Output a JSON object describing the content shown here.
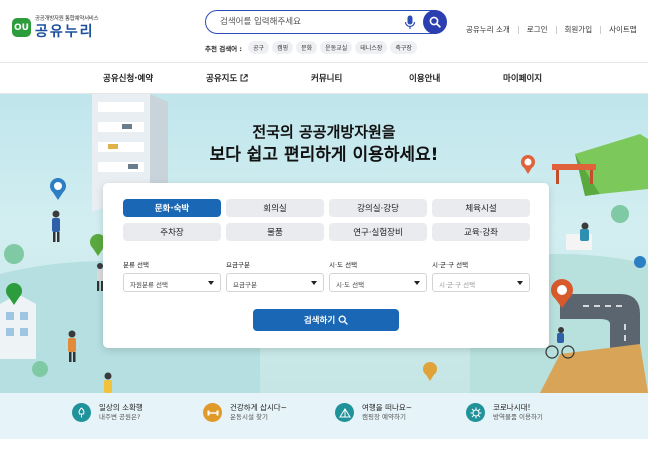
{
  "brand": {
    "mark": "OU",
    "subtitle": "공공개방자원 통합예약서비스",
    "name": "공유누리"
  },
  "search": {
    "placeholder": "검색어를 입력해주세요",
    "recommended_label": "추천 검색어 :",
    "recommended": [
      "공구",
      "캠핑",
      "문화",
      "운동교실",
      "테니스장",
      "축구장"
    ]
  },
  "utility_links": [
    "공유누리 소개",
    "로그인",
    "회원가입",
    "사이트맵"
  ],
  "nav": [
    "공유신청·예약",
    "공유지도",
    "커뮤니티",
    "이용안내",
    "마이페이지"
  ],
  "hero": {
    "title_line1": "전국의 공공개방자원을",
    "title_line2": "보다 쉽고 편리하게 이용하세요!"
  },
  "categories": [
    {
      "label": "문화·숙박",
      "active": true
    },
    {
      "label": "회의실",
      "active": false
    },
    {
      "label": "강의실·강당",
      "active": false
    },
    {
      "label": "체육시설",
      "active": false
    },
    {
      "label": "주차장",
      "active": false
    },
    {
      "label": "물품",
      "active": false
    },
    {
      "label": "연구·실험장비",
      "active": false
    },
    {
      "label": "교육·강좌",
      "active": false
    }
  ],
  "filters": [
    {
      "label": "분류 선택",
      "selected": "자원분류 선택"
    },
    {
      "label": "요금구분",
      "selected": "요금구분"
    },
    {
      "label": "시·도 선택",
      "selected": "시·도 선택"
    },
    {
      "label": "시·군·구 선택",
      "selected": "시·군·구 선택"
    }
  ],
  "search_button": "검색하기",
  "quick_links": [
    {
      "title": "일상의 소확행",
      "sub": "내주변 공원은?",
      "icon": "tree-icon"
    },
    {
      "title": "건강하게 삽시다~",
      "sub": "운동시설 찾기",
      "icon": "dumbbell-icon"
    },
    {
      "title": "여행을 떠나요~",
      "sub": "캠핑장 예약하기",
      "icon": "tent-icon"
    },
    {
      "title": "코로나시대!",
      "sub": "방역물품 이용하기",
      "icon": "virus-icon"
    }
  ],
  "colors": {
    "primary": "#1a68b5",
    "search_border": "#2c4db7",
    "teal": "#20929a",
    "logo_green": "#2d9c3c"
  }
}
